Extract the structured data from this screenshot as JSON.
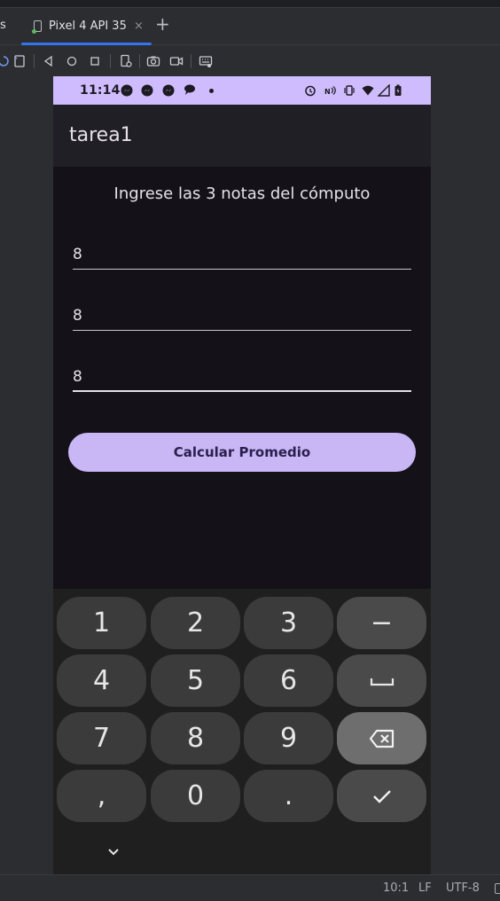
{
  "ide": {
    "prev_tab_label": "s",
    "active_tab_label": "Pixel 4 API 35",
    "tab_close_glyph": "×",
    "add_tab_glyph": "+",
    "toolbar_icons": [
      "rotate-icon",
      "fold-icon",
      "back-icon",
      "home-icon",
      "overview-icon",
      "device-settings-icon",
      "camera-icon",
      "video-icon",
      "keyboard-icon"
    ],
    "status": {
      "position": "10:1",
      "line_ending": "LF",
      "encoding": "UTF-8"
    }
  },
  "phone": {
    "status_bar": {
      "time": "11:14",
      "notification_icons": [
        "messenger-icon",
        "messenger-icon",
        "messenger-icon",
        "chat-bubble-icon"
      ],
      "system_icons": [
        "alarm-icon",
        "nfc-icon",
        "vibrate-icon",
        "wifi-icon",
        "signal-icon",
        "battery-icon"
      ],
      "background": "#cfbcff"
    },
    "app": {
      "title": "tarea1",
      "prompt": "Ingrese las 3 notas del cómputo",
      "fields": [
        {
          "value": "8"
        },
        {
          "value": "8"
        },
        {
          "value": "8"
        }
      ],
      "button_label": "Calcular Promedio",
      "button_color": "#c8b6f5"
    },
    "keyboard": {
      "keys": [
        "1",
        "2",
        "3",
        "−",
        "4",
        "5",
        "6",
        "space-icon",
        "7",
        "8",
        "9",
        "backspace-icon",
        ",",
        "0",
        ".",
        "check-icon"
      ]
    }
  }
}
